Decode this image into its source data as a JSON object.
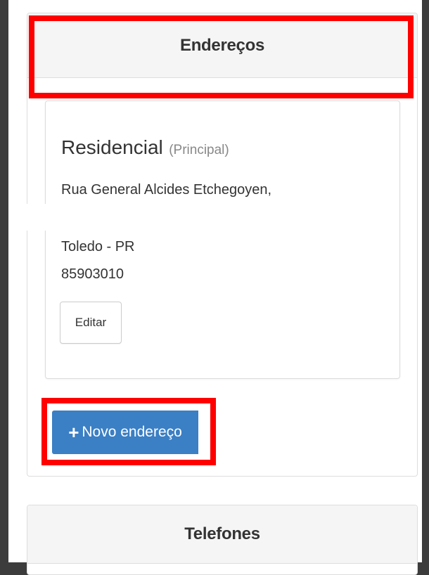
{
  "addresses_panel": {
    "title": "Endereços"
  },
  "address_card": {
    "type": "Residencial",
    "principal": "(Principal)",
    "street": "Rua General Alcides Etchegoyen,",
    "city_state": "Toledo - PR",
    "zip": "85903010",
    "edit_label": "Editar"
  },
  "new_address": {
    "label": "Novo endereço",
    "icon": "plus-icon",
    "color": "#3b7fc4"
  },
  "phones_panel": {
    "title": "Telefones"
  },
  "highlight_color": "#ff0000"
}
